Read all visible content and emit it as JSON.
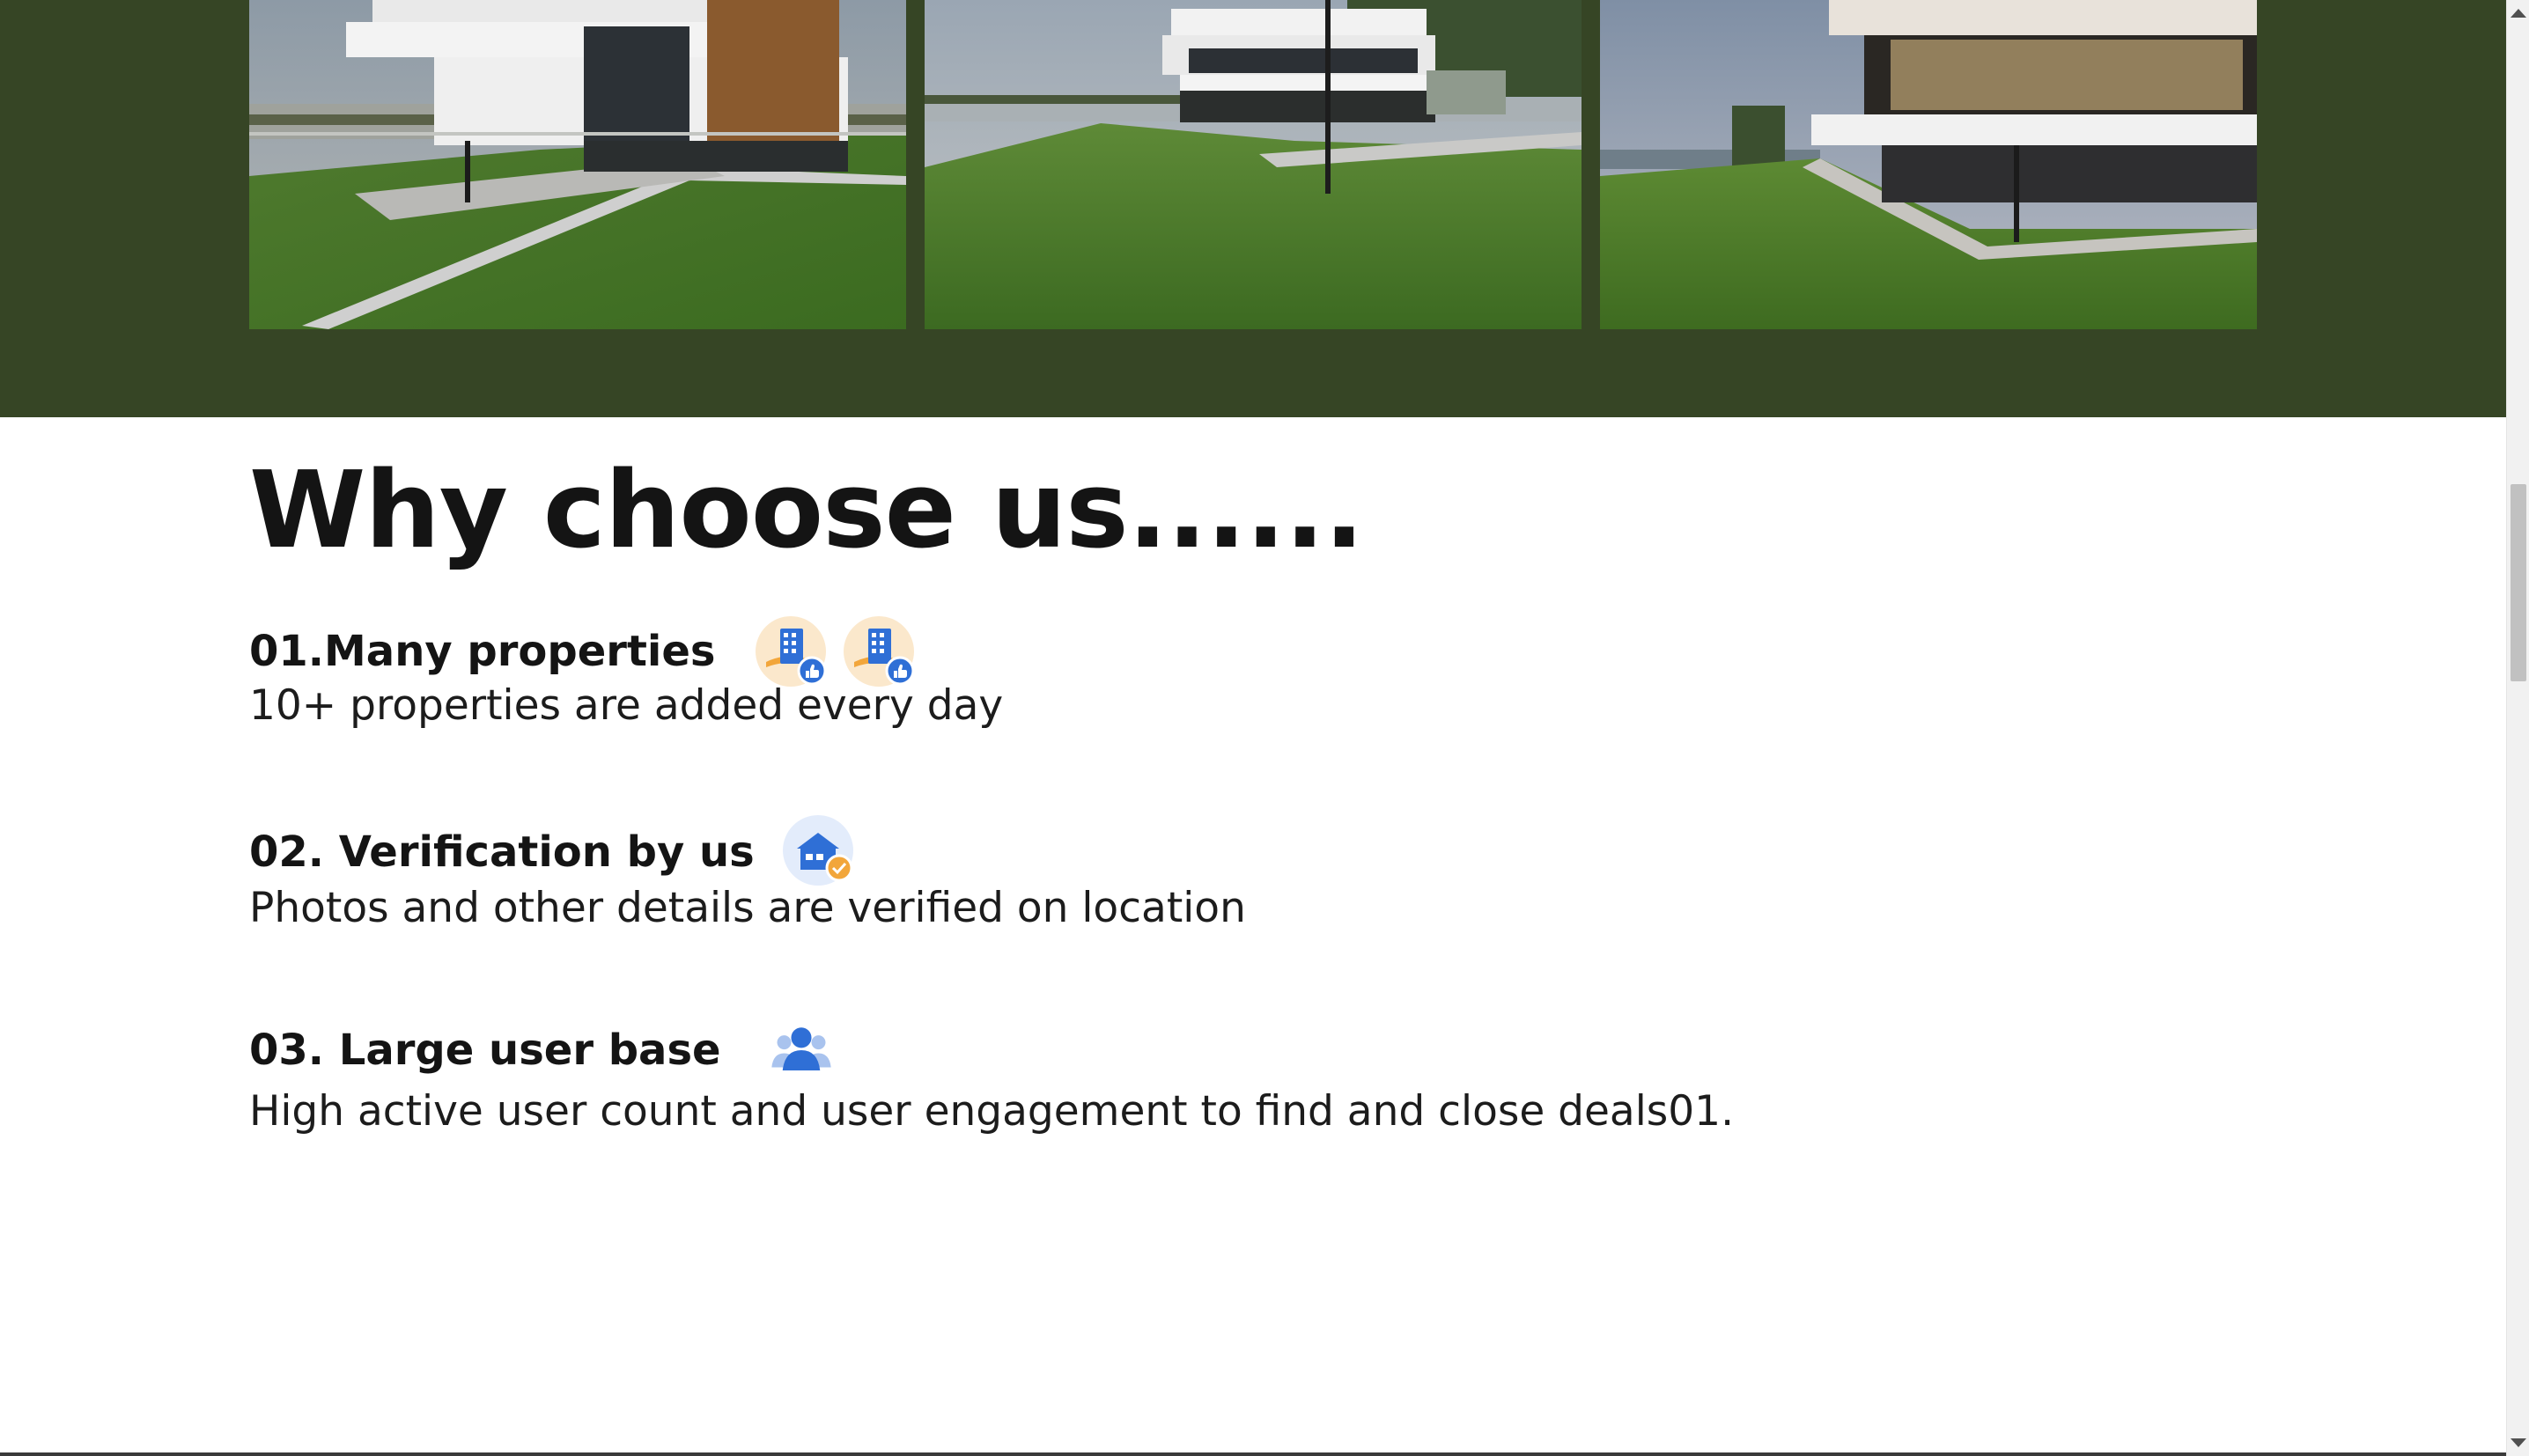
{
  "gallery": {
    "photos": [
      {
        "alt": "modern-villa-lake-view-1"
      },
      {
        "alt": "modern-villa-lake-view-2"
      },
      {
        "alt": "modern-villa-lake-view-3"
      }
    ],
    "band_color": "#364525"
  },
  "why_section": {
    "title": "Why choose us......",
    "features": [
      {
        "title": "01.Many properties",
        "description": "10+ properties are added every day",
        "icons": [
          "building-thumbs-up-icon",
          "building-thumbs-up-icon"
        ]
      },
      {
        "title": "02. Verification by us",
        "description": "Photos and other details are verified on location",
        "icons": [
          "house-verified-icon"
        ]
      },
      {
        "title": "03. Large user base",
        "description": "High active user count and user engagement to find and close deals01.",
        "icons": [
          "users-group-icon"
        ]
      }
    ]
  },
  "colors": {
    "accent_blue": "#2f6fd6",
    "accent_orange": "#f2a63b",
    "text": "#141414"
  }
}
